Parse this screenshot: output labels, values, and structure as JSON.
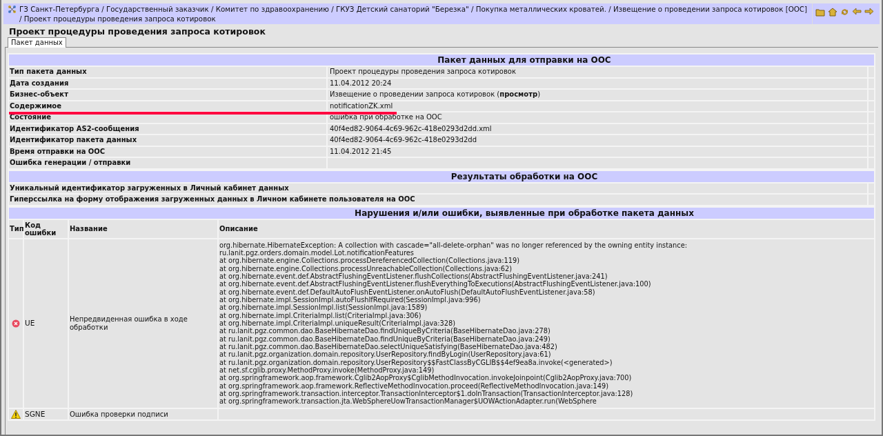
{
  "breadcrumb": "ГЗ Санкт-Петербурга / Государственный заказчик / Комитет по здравоохранению / ГКУЗ Детский санаторий \"Березка\" / Покупка металлических кроватей. / Извещение о проведении запроса котировок [ООС] / Проект процедуры проведения запроса котировок",
  "page_title": "Проект процедуры проведения запроса котировок",
  "tabs": [
    {
      "label": "Пакет данных",
      "selected": true
    }
  ],
  "package_section": {
    "title": "Пакет данных для отправки на ООС",
    "rows": [
      {
        "label": "Тип пакета данных",
        "value": "Проект процедуры проведения запроса котировок",
        "underlined": false
      },
      {
        "label": "Дата создания",
        "value": "11.04.2012 20:24",
        "underlined": false
      },
      {
        "label": "Бизнес-объект",
        "value": "Извещение о проведении запроса котировок (**просмотр**)",
        "underlined": false
      },
      {
        "label": "Содержимое",
        "value": "notificationZK.xml",
        "underlined": true
      },
      {
        "label": "Состояние",
        "value": "ошибка при обработке на ООС",
        "underlined": false
      },
      {
        "label": "Идентификатор AS2-сообщения",
        "value": "40f4ed82-9064-4c69-962c-418e0293d2dd.xml",
        "underlined": false
      },
      {
        "label": "Идентификатор пакета данных",
        "value": "40f4ed82-9064-4c69-962c-418e0293d2dd",
        "underlined": false
      },
      {
        "label": "Время отправки на ООС",
        "value": "11.04.2012 21:45",
        "underlined": false
      },
      {
        "label": "Ошибка генерации / отправки",
        "value": "",
        "underlined": false
      }
    ]
  },
  "results_section": {
    "title": "Результаты обработки на ООС",
    "rows": [
      {
        "label": "Уникальный идентификатор загруженных в Личный кабинет данных"
      },
      {
        "label": "Гиперссылка на форму отображения загруженных данных в Личном кабинете пользователя на ООС"
      }
    ]
  },
  "errors_section": {
    "title": "Нарушения и/или ошибки, выявленные при обработке пакета данных",
    "columns": [
      "Тип",
      "Код ошибки",
      "Название",
      "Описание"
    ],
    "rows": [
      {
        "kind": "error",
        "code": "UE",
        "name": "Непредвиденная ошибка в ходе обработки",
        "description": [
          "org.hibernate.HibernateException: A collection with cascade=\"all-delete-orphan\" was no longer referenced by the owning entity instance:",
          "ru.lanit.pgz.orders.domain.model.Lot.notificationFeatures",
          "at org.hibernate.engine.Collections.processDereferencedCollection(Collections.java:119)",
          "at org.hibernate.engine.Collections.processUnreachableCollection(Collections.java:62)",
          "at org.hibernate.event.def.AbstractFlushingEventListener.flushCollections(AbstractFlushingEventListener.java:241)",
          "at org.hibernate.event.def.AbstractFlushingEventListener.flushEverythingToExecutions(AbstractFlushingEventListener.java:100)",
          "at org.hibernate.event.def.DefaultAutoFlushEventListener.onAutoFlush(DefaultAutoFlushEventListener.java:58)",
          "at org.hibernate.impl.SessionImpl.autoFlushIfRequired(SessionImpl.java:996)",
          "at org.hibernate.impl.SessionImpl.list(SessionImpl.java:1589)",
          "at org.hibernate.impl.CriteriaImpl.list(CriteriaImpl.java:306)",
          "at org.hibernate.impl.CriteriaImpl.uniqueResult(CriteriaImpl.java:328)",
          "at ru.lanit.pgz.common.dao.BaseHibernateDao.findUniqueByCriteria(BaseHibernateDao.java:278)",
          "at ru.lanit.pgz.common.dao.BaseHibernateDao.findUniqueByCriteria(BaseHibernateDao.java:249)",
          "at ru.lanit.pgz.common.dao.BaseHibernateDao.selectUniqueSatisfying(BaseHibernateDao.java:482)",
          "at ru.lanit.pgz.organization.domain.repository.UserRepository.findByLogin(UserRepository.java:61)",
          "at ru.lanit.pgz.organization.domain.repository.UserRepository$$FastClassByCGLIB$$4ef9ea8a.invoke(<generated>)",
          "at net.sf.cglib.proxy.MethodProxy.invoke(MethodProxy.java:149)",
          "at org.springframework.aop.framework.Cglib2AopProxy$CglibMethodInvocation.invokeJoinpoint(Cglib2AopProxy.java:700)",
          "at org.springframework.aop.framework.ReflectiveMethodInvocation.proceed(ReflectiveMethodInvocation.java:149)",
          "at org.springframework.transaction.interceptor.TransactionInterceptor$1.doInTransaction(TransactionInterceptor.java:128)",
          "at org.springframework.transaction.jta.WebSphereUowTransactionManager$UOWActionAdapter.run(WebSphere"
        ]
      },
      {
        "kind": "warning",
        "code": "SGNE",
        "name": "Ошибка проверки подписи",
        "description": []
      }
    ]
  }
}
